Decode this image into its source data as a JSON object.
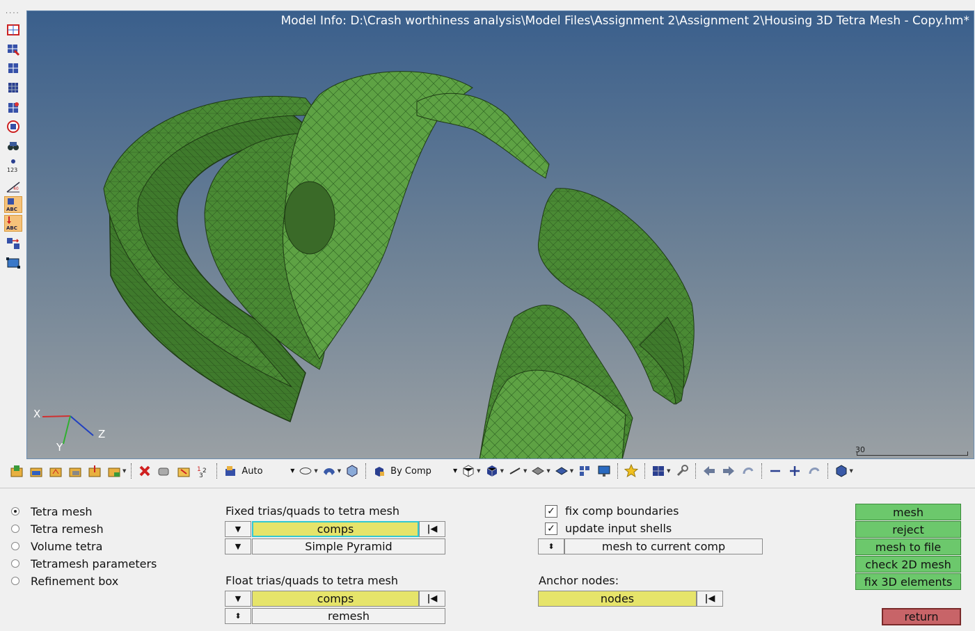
{
  "viewport": {
    "model_info": "Model Info: D:\\Crash worthiness analysis\\Model Files\\Assignment 2\\Assignment 2\\Housing 3D Tetra Mesh - Copy.hm*",
    "scale_value": "30",
    "axes": {
      "x": "X",
      "y": "Y",
      "z": "Z"
    }
  },
  "left_toolbar": {
    "icons": [
      "elements-icon",
      "element-mask-icon",
      "display-elements-icon",
      "tetra-elements-icon",
      "shell-check-icon",
      "no-select-icon",
      "find-icon",
      "node-id-icon",
      "measure-icon",
      "label-abc-icon",
      "load-abc-icon",
      "transfer-icon",
      "plane-icon"
    ]
  },
  "view_toolbar": {
    "auto_label": "Auto",
    "by_comp_label": "By Comp"
  },
  "panel": {
    "modes": [
      {
        "label": "Tetra mesh",
        "selected": true
      },
      {
        "label": "Tetra remesh",
        "selected": false
      },
      {
        "label": "Volume tetra",
        "selected": false
      },
      {
        "label": "Tetramesh parameters",
        "selected": false
      },
      {
        "label": "Refinement box",
        "selected": false
      }
    ],
    "fixed": {
      "title": "Fixed trias/quads to tetra mesh",
      "selector": "comps",
      "option": "Simple Pyramid"
    },
    "float": {
      "title": "Float trias/quads to tetra mesh",
      "selector": "comps",
      "option": "remesh"
    },
    "options": {
      "fix_comp_boundaries": {
        "label": "fix comp boundaries",
        "checked": true
      },
      "update_input_shells": {
        "label": "update input shells",
        "checked": true
      },
      "destination": "mesh to current comp"
    },
    "anchor": {
      "title": "Anchor nodes:",
      "selector": "nodes"
    },
    "actions": {
      "mesh": "mesh",
      "reject": "reject",
      "mesh_to_file": "mesh to file",
      "check_2d_mesh": "check 2D mesh",
      "fix_3d_elements": "fix 3D elements",
      "return": "return"
    },
    "colors": {
      "action_green": "#6cc86c",
      "selector_yellow": "#e6e46a",
      "return_red": "#c86468"
    }
  }
}
